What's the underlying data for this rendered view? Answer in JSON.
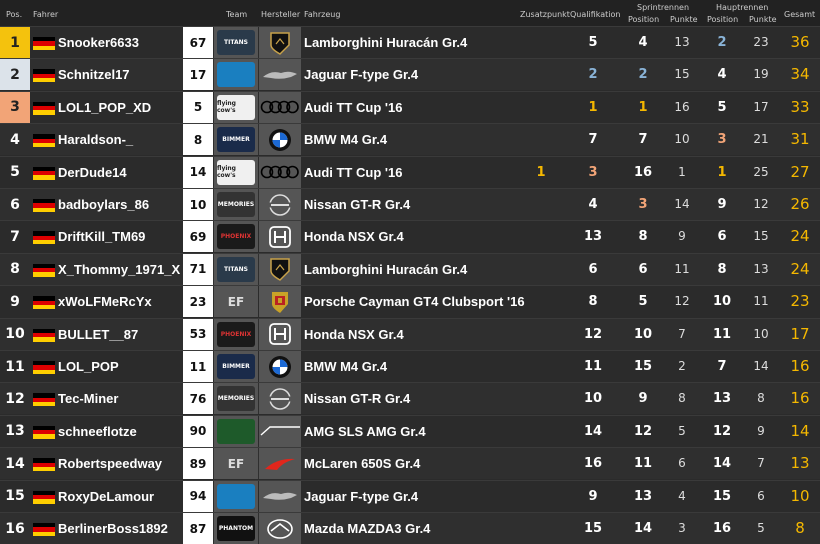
{
  "header": {
    "pos": "Pos.",
    "driver": "Fahrer",
    "team": "Team",
    "maker": "Hersteller",
    "vehicle": "Fahrzeug",
    "extra": "Zusatzpunkt",
    "qual": "Qualifikation",
    "sprint": "Sprintrennen",
    "sprint_pos": "Position",
    "sprint_pts": "Punkte",
    "main": "Hauptrennen",
    "main_pos": "Position",
    "main_pts": "Punkte",
    "total": "Gesamt"
  },
  "colors": {
    "gold": "#f5b800",
    "silver": "#8ab4d8",
    "bronze": "#f2a477",
    "p1": "#f4c20d",
    "p2": "#dce3ea",
    "p3": "#f2a477"
  },
  "rows": [
    {
      "pos": "1",
      "driver": "Snooker6633",
      "num": "67",
      "team": "titans",
      "maker": "lamborghini-icon",
      "vehicle": "Lamborghini Huracán Gr.4",
      "extra": "",
      "qual": "5",
      "spos": "4",
      "spts": "13",
      "hpos": "2",
      "hpts": "23",
      "total": "36"
    },
    {
      "pos": "2",
      "driver": "Schnitzel17",
      "num": "17",
      "team": "sunset",
      "maker": "jaguar-icon",
      "vehicle": "Jaguar F-type Gr.4",
      "extra": "",
      "qual": "2",
      "spos": "2",
      "spts": "15",
      "hpos": "4",
      "hpts": "19",
      "total": "34"
    },
    {
      "pos": "3",
      "driver": "LOL1_POP_XD",
      "num": "5",
      "team": "flying cow's",
      "maker": "audi-icon",
      "vehicle": "Audi TT Cup '16",
      "extra": "",
      "qual": "1",
      "spos": "1",
      "spts": "16",
      "hpos": "5",
      "hpts": "17",
      "total": "33"
    },
    {
      "pos": "4",
      "driver": "Haraldson-_",
      "num": "8",
      "team": "BIMMER RACING",
      "maker": "bmw-icon",
      "vehicle": "BMW M4 Gr.4",
      "extra": "",
      "qual": "7",
      "spos": "7",
      "spts": "10",
      "hpos": "3",
      "hpts": "21",
      "total": "31"
    },
    {
      "pos": "5",
      "driver": "DerDude14",
      "num": "14",
      "team": "flying cow's",
      "maker": "audi-icon",
      "vehicle": "Audi TT Cup '16",
      "extra": "1",
      "qual": "3",
      "spos": "16",
      "spts": "1",
      "hpos": "1",
      "hpts": "25",
      "total": "27"
    },
    {
      "pos": "6",
      "driver": "badboylars_86",
      "num": "10",
      "team": "MEMORIES",
      "maker": "nissan-icon",
      "vehicle": "Nissan GT-R Gr.4",
      "extra": "",
      "qual": "4",
      "spos": "3",
      "spts": "14",
      "hpos": "9",
      "hpts": "12",
      "total": "26"
    },
    {
      "pos": "7",
      "driver": "DriftKill_TM69",
      "num": "69",
      "team": "PHOENIX",
      "maker": "honda-icon",
      "vehicle": "Honda NSX Gr.4",
      "extra": "",
      "qual": "13",
      "spos": "8",
      "spts": "9",
      "hpos": "6",
      "hpts": "15",
      "total": "24"
    },
    {
      "pos": "8",
      "driver": "X_Thommy_1971_X",
      "num": "71",
      "team": "titans",
      "maker": "lamborghini-icon",
      "vehicle": "Lamborghini Huracán Gr.4",
      "extra": "",
      "qual": "6",
      "spos": "6",
      "spts": "11",
      "hpos": "8",
      "hpts": "13",
      "total": "24"
    },
    {
      "pos": "9",
      "driver": "xWoLFMeRcYx",
      "num": "23",
      "team": "EF",
      "maker": "porsche-icon",
      "vehicle": "Porsche Cayman GT4 Clubsport '16",
      "extra": "",
      "qual": "8",
      "spos": "5",
      "spts": "12",
      "hpos": "10",
      "hpts": "11",
      "total": "23"
    },
    {
      "pos": "10",
      "driver": "BULLET__87",
      "num": "53",
      "team": "PHOENIX",
      "maker": "honda-icon",
      "vehicle": "Honda NSX Gr.4",
      "extra": "",
      "qual": "12",
      "spos": "10",
      "spts": "7",
      "hpos": "11",
      "hpts": "10",
      "total": "17"
    },
    {
      "pos": "11",
      "driver": "LOL_POP",
      "num": "11",
      "team": "BIMMER RACING",
      "maker": "bmw-icon",
      "vehicle": "BMW M4 Gr.4",
      "extra": "",
      "qual": "11",
      "spos": "15",
      "spts": "2",
      "hpos": "7",
      "hpts": "14",
      "total": "16"
    },
    {
      "pos": "12",
      "driver": "Tec-Miner",
      "num": "76",
      "team": "MEMORIES",
      "maker": "nissan-icon",
      "vehicle": "Nissan GT-R Gr.4",
      "extra": "",
      "qual": "10",
      "spos": "9",
      "spts": "8",
      "hpos": "13",
      "hpts": "8",
      "total": "16"
    },
    {
      "pos": "13",
      "driver": "schneeflotze",
      "num": "90",
      "team": "green",
      "maker": "amg-icon",
      "vehicle": "AMG SLS AMG Gr.4",
      "extra": "",
      "qual": "14",
      "spos": "12",
      "spts": "5",
      "hpos": "12",
      "hpts": "9",
      "total": "14"
    },
    {
      "pos": "14",
      "driver": "Robertspeedway",
      "num": "89",
      "team": "EF",
      "maker": "mclaren-icon",
      "vehicle": "McLaren 650S Gr.4",
      "extra": "",
      "qual": "16",
      "spos": "11",
      "spts": "6",
      "hpos": "14",
      "hpts": "7",
      "total": "13"
    },
    {
      "pos": "15",
      "driver": "RoxyDeLamour",
      "num": "94",
      "team": "sunset",
      "maker": "jaguar-icon",
      "vehicle": "Jaguar F-type Gr.4",
      "extra": "",
      "qual": "9",
      "spos": "13",
      "spts": "4",
      "hpos": "15",
      "hpts": "6",
      "total": "10"
    },
    {
      "pos": "16",
      "driver": "BerlinerBoss1892",
      "num": "87",
      "team": "PHANTOM",
      "maker": "mazda-icon",
      "vehicle": "Mazda MAZDA3 Gr.4",
      "extra": "",
      "qual": "15",
      "spos": "14",
      "spts": "3",
      "hpos": "16",
      "hpts": "5",
      "total": "8"
    }
  ]
}
